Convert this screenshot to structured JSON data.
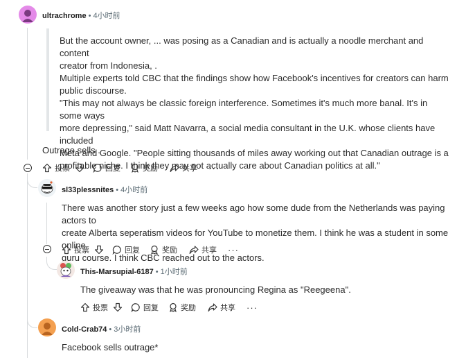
{
  "colors": {
    "accent_avatar_1": "#e48ae8",
    "avatar_orange": "#f4a050",
    "meta_gray": "#5b6b74"
  },
  "comments": [
    {
      "username": "ultrachrome",
      "time": "4小时前",
      "quote_lines": [
        "But the account owner, ... was posing as a Canadian and is actually a noodle merchant and content",
        "creator from Indonesia, .",
        "Multiple experts told CBC that the findings show how Facebook's incentives for creators can harm",
        "public discourse.",
        "\"This may not always be classic foreign interference. Sometimes it's much more banal. It's in some ways",
        "more depressing,\" said Matt Navarra, a social media consultant in the U.K. whose clients have included",
        "Meta and Google. \"People sitting thousands of miles away working out that Canadian outrage is a",
        "profitable niche. I think they may not actually care about Canadian politics at all.\""
      ],
      "text": "Outrage sells ."
    },
    {
      "username": "sl33plessnites",
      "time": "4小时前",
      "lines": [
        "There was another story just a few weeks ago how some dude from the Netherlands was paying actors to",
        "create Alberta seperatism videos for YouTube to monetize them. I think he was a student in some online",
        "guru course. I think CBC reached out to the actors."
      ]
    },
    {
      "username": "This-Marsupial-6187",
      "time": "1小时前",
      "text": "The giveaway was that he was pronouncing Regina as \"Reegeena\"."
    },
    {
      "username": "Cold-Crab74",
      "time": "3小时前",
      "text": "Facebook sells outrage*"
    }
  ],
  "actions": {
    "vote": "投票",
    "reply": "回复",
    "award": "奖励",
    "share": "共享",
    "more": "···"
  },
  "separator": "•"
}
